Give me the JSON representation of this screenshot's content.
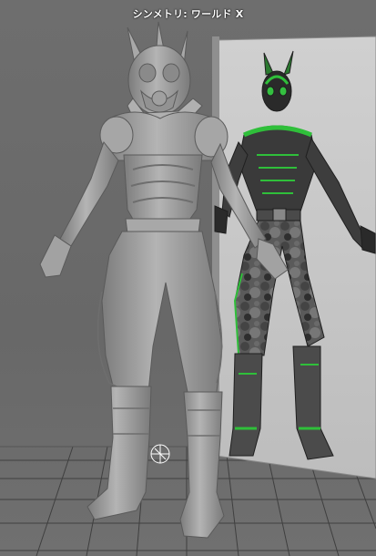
{
  "viewport": {
    "hud": {
      "symmetry_label": "シンメトリ: ワールド X"
    },
    "colors": {
      "background": "#6a6a6a",
      "grid": "#3a3a3a",
      "reference_plane": "#c6c6c6",
      "model_gray": "#9a9a9a",
      "accent_green": "#2fbf3a"
    }
  }
}
